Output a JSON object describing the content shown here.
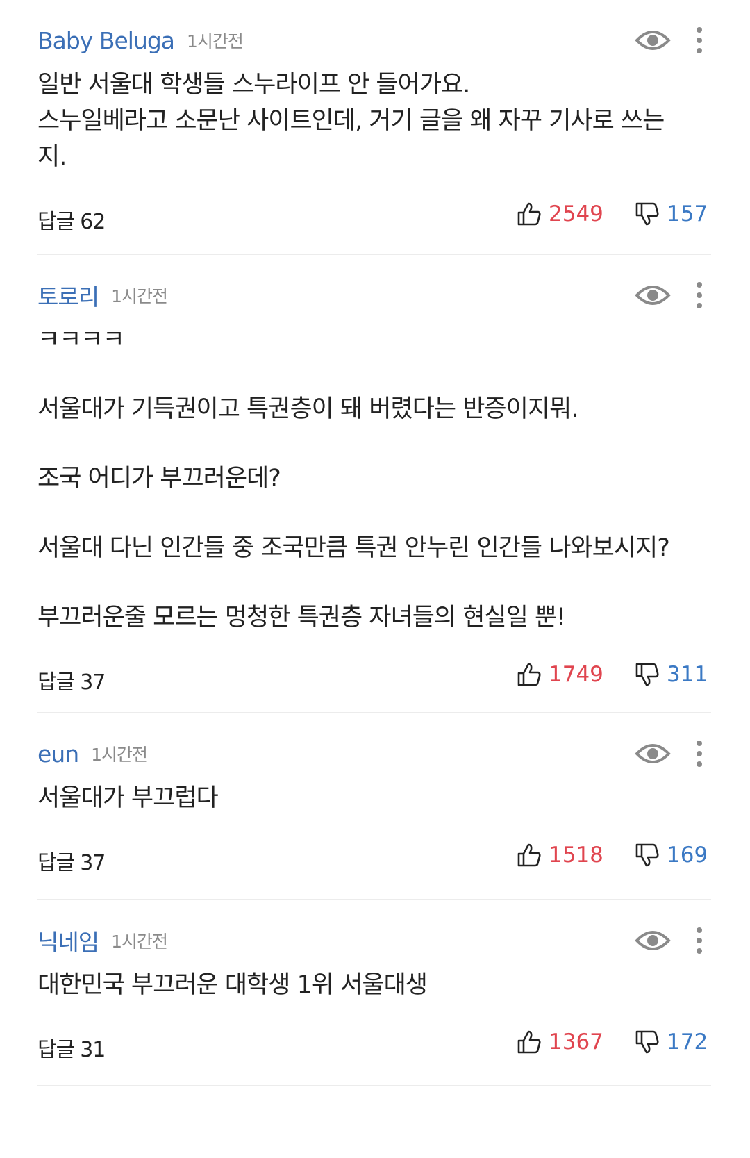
{
  "comments": [
    {
      "author": "Baby Beluga",
      "time": "1시간전",
      "lines": [
        "일반 서울대 학생들 스누라이프 안 들어가요.",
        "스누일베라고 소문난 사이트인데, 거기 글을 왜 자꾸 기사로 쓰는",
        "지."
      ],
      "reply_label": "답글",
      "reply_count": "62",
      "likes": "2549",
      "dislikes": "157"
    },
    {
      "author": "토로리",
      "time": "1시간전",
      "lines": [
        "ㅋㅋㅋㅋ",
        "서울대가 기득권이고 특권층이 돼 버렸다는 반증이지뭐.",
        "조국 어디가 부끄러운데?",
        "서울대 다닌 인간들 중 조국만큼 특권 안누린 인간들 나와보시지?",
        "부끄러운줄 모르는 멍청한 특권층 자녀들의 현실일 뿐!"
      ],
      "reply_label": "답글",
      "reply_count": "37",
      "likes": "1749",
      "dislikes": "311"
    },
    {
      "author": "eun",
      "time": "1시간전",
      "lines": [
        "서울대가 부끄럽다"
      ],
      "reply_label": "답글",
      "reply_count": "37",
      "likes": "1518",
      "dislikes": "169"
    },
    {
      "author": "닉네임",
      "time": "1시간전",
      "lines": [
        "대한민국 부끄러운 대학생 1위 서울대생"
      ],
      "reply_label": "답글",
      "reply_count": "31",
      "likes": "1367",
      "dislikes": "172"
    }
  ],
  "colors": {
    "author": "#3b6fb6",
    "time": "#8a8a8a",
    "like": "#e0454f",
    "dislike": "#3b79c4",
    "divider": "#ececec"
  },
  "icons": [
    "eye-icon",
    "more-vertical-icon",
    "thumbs-up-icon",
    "thumbs-down-icon"
  ]
}
